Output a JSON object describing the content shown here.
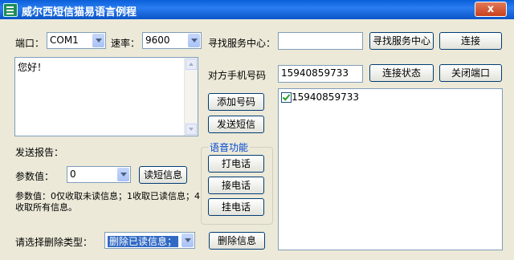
{
  "window": {
    "title": "威尔西短信猫易语言例程",
    "close_label": "x"
  },
  "port": {
    "label": "端口：",
    "value": "COM1"
  },
  "baud": {
    "label": "速率：",
    "value": "9600"
  },
  "service_center": {
    "label": "寻找服务中心：",
    "value": "",
    "find_button": "寻找服务中心",
    "connect_button": "连接"
  },
  "message": {
    "text": "您好！"
  },
  "phone": {
    "label": "对方手机号码",
    "value": "15940859733"
  },
  "buttons": {
    "status": "连接状态",
    "close_port": "关闭端口",
    "add_number": "添加号码",
    "send_sms": "发送短信",
    "read_sms": "读短信息",
    "delete_msg": "删除信息"
  },
  "voice": {
    "title": "语音功能",
    "call": "打电话",
    "answer": "接电话",
    "hangup": "挂电话"
  },
  "numbers_list": [
    {
      "number": "15940859733",
      "checked": true
    }
  ],
  "report": {
    "label": "发送报告："
  },
  "param": {
    "label": "参数值：",
    "value": "0",
    "help": "参数值：0仅收取未读信息；1收取已读信息；4收取所有信息。"
  },
  "delete": {
    "label": "请选择删除类型：",
    "value": "删除已读信息；"
  }
}
